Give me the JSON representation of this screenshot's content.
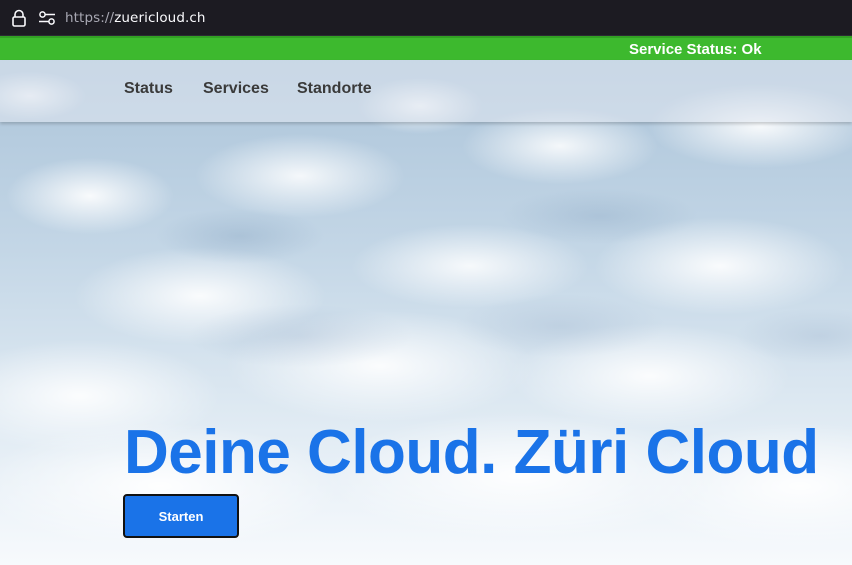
{
  "browser": {
    "url_scheme": "https://",
    "url_host": "zuericloud.ch",
    "icons": [
      "lock-icon",
      "tune-icon"
    ]
  },
  "status_bar": {
    "text": "Service Status: Ok",
    "color": "#3db92e"
  },
  "nav": {
    "items": [
      {
        "label": "Status"
      },
      {
        "label": "Services"
      },
      {
        "label": "Standorte"
      }
    ]
  },
  "hero": {
    "title": "Deine Cloud. Züri Cloud",
    "title_color": "#1a73e8",
    "button_label": "Starten"
  }
}
